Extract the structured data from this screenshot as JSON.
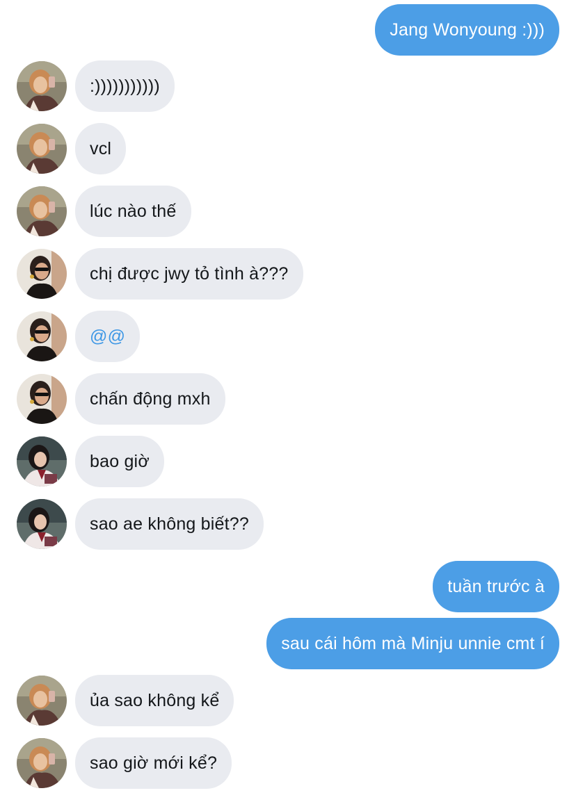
{
  "conversation": {
    "messages": [
      {
        "side": "out",
        "text": "Jang Wonyoung :)))"
      },
      {
        "side": "in",
        "avatar": "avatar-a",
        "text": ":)))))))))))"
      },
      {
        "side": "in",
        "avatar": "avatar-a",
        "text": "vcl"
      },
      {
        "side": "in",
        "avatar": "avatar-a",
        "text": "lúc nào thế"
      },
      {
        "side": "in",
        "avatar": "avatar-b",
        "text": "chị được jwy tỏ tình à???"
      },
      {
        "side": "in",
        "avatar": "avatar-b",
        "text": "@@"
      },
      {
        "side": "in",
        "avatar": "avatar-b",
        "text": "chấn động mxh"
      },
      {
        "side": "in",
        "avatar": "avatar-c",
        "text": "bao giờ"
      },
      {
        "side": "in",
        "avatar": "avatar-c",
        "text": "sao ae không biết??"
      },
      {
        "side": "out",
        "text": "tuần trước à"
      },
      {
        "side": "out",
        "text": "sau cái hôm mà Minju unnie cmt í"
      },
      {
        "side": "in",
        "avatar": "avatar-a",
        "text": "ủa sao không kể"
      },
      {
        "side": "in",
        "avatar": "avatar-a",
        "text": "sao giờ mới kể?"
      }
    ]
  },
  "colors": {
    "outgoing_bubble": "#4c9ee6",
    "incoming_bubble": "#e9ebf0",
    "mention": "#3d97e5"
  }
}
